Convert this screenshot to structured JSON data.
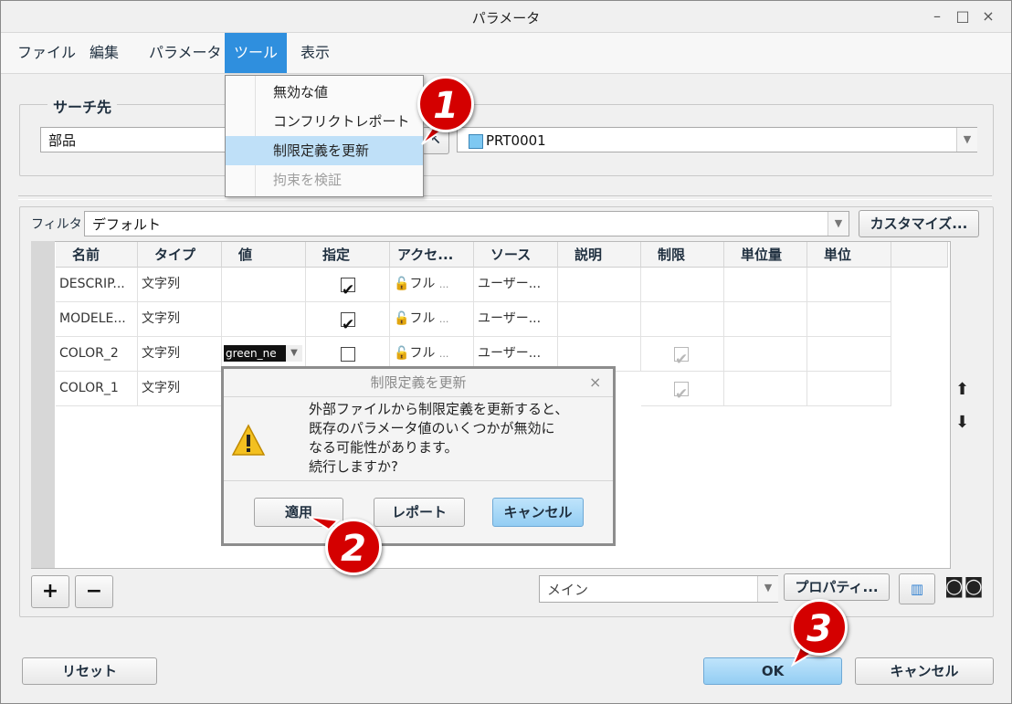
{
  "window": {
    "title": "パラメータ",
    "min": "–",
    "max": "□",
    "close": "×"
  },
  "menu": {
    "items": [
      "ファイル",
      "編集",
      "パラメータ",
      "ツール",
      "表示"
    ],
    "active_index": 3
  },
  "search": {
    "label": "サーチ先",
    "scope_value": "部品",
    "model_value": "PRT0001"
  },
  "tools_menu": {
    "items": [
      "無効な値",
      "コンフリクトレポート",
      "制限定義を更新",
      "拘束を検証"
    ]
  },
  "filter": {
    "label": "フィルタ",
    "value": "デフォルト",
    "customize_button": "カスタマイズ..."
  },
  "table": {
    "headers": [
      "名前",
      "タイプ",
      "値",
      "指定",
      "アクセ...",
      "ソース",
      "説明",
      "制限",
      "単位量",
      "単位"
    ],
    "rows": [
      {
        "name": "DESCRIP...",
        "type": "文字列",
        "value": "",
        "designated": true,
        "access": "フル",
        "source": "ユーザー...",
        "restricted": null
      },
      {
        "name": "MODELE...",
        "type": "文字列",
        "value": "",
        "designated": true,
        "access": "フル",
        "source": "ユーザー...",
        "restricted": null
      },
      {
        "name": "COLOR_2",
        "type": "文字列",
        "value": "green_ne",
        "designated": false,
        "access": "フル",
        "source": "ユーザー...",
        "restricted": true
      },
      {
        "name": "COLOR_1",
        "type": "文字列",
        "value": "",
        "designated": false,
        "access": "",
        "source": "",
        "restricted": true
      }
    ],
    "access_ellipsis": "..."
  },
  "dialog": {
    "title": "制限定義を更新",
    "close": "×",
    "message_lines": [
      "外部ファイルから制限定義を更新すると、",
      "既存のパラメータ値のいくつかが無効に",
      "なる可能性があります。",
      "続行しますか?"
    ],
    "buttons": {
      "apply": "適用",
      "report": "レポート",
      "cancel": "キャンセル"
    }
  },
  "bottom_bar": {
    "add": "+",
    "remove": "−",
    "view_value": "メイン",
    "properties_button": "プロパティ..."
  },
  "footer": {
    "reset": "リセット",
    "ok": "OK",
    "cancel": "キャンセル"
  },
  "callouts": [
    "1",
    "2",
    "3"
  ],
  "colors": {
    "accent": "#2f8fde",
    "callout": "#d40000",
    "blue_button": "#93cdf3"
  }
}
